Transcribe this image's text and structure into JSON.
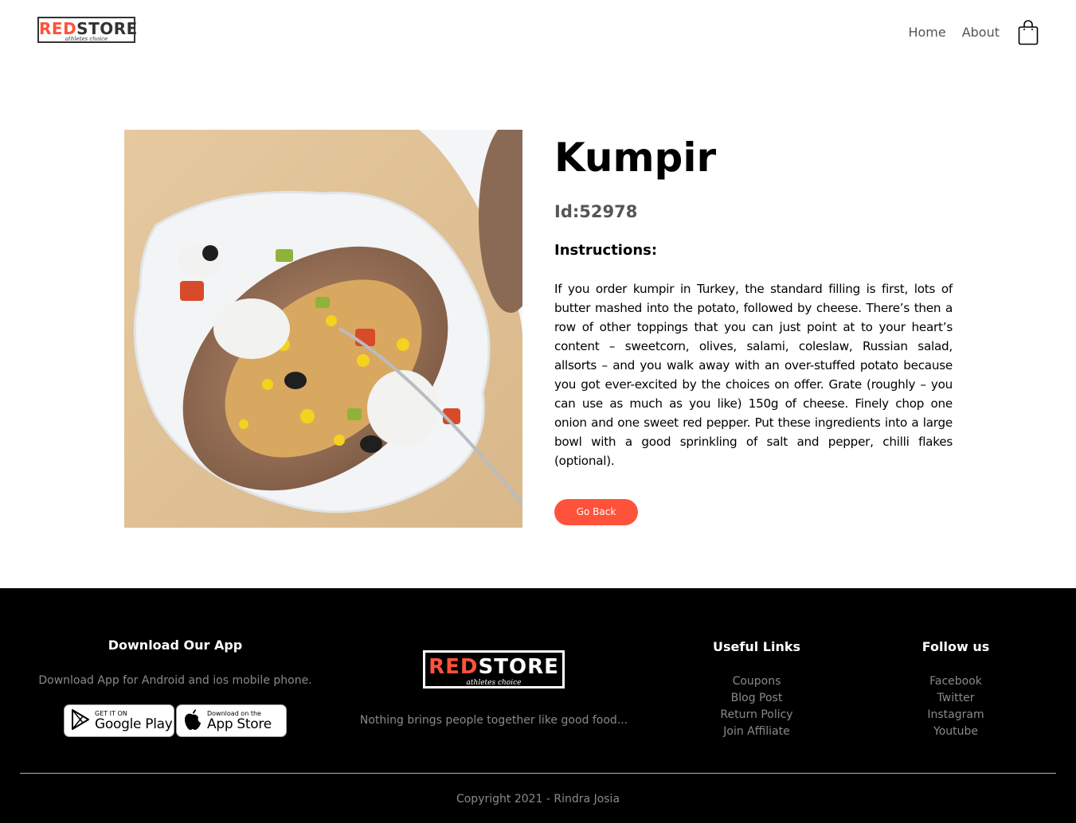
{
  "header": {
    "logo_word_red": "RED",
    "logo_word_dark": "STORE",
    "logo_tagline": "athletes choice",
    "nav": [
      {
        "label": "Home"
      },
      {
        "label": "About"
      }
    ],
    "cart_icon": "shopping-bag-icon"
  },
  "product": {
    "image_subject": "kumpir baked potato with toppings",
    "title": "Kumpir",
    "id_text": "Id:52978",
    "instructions_heading": "Instructions:",
    "instructions": "If you order kumpir in Turkey, the standard filling is first, lots of butter mashed into the potato, followed by cheese. There’s then a row of other toppings that you can just point at to your heart’s content – sweetcorn, olives, salami, coleslaw, Russian salad, allsorts – and you walk away with an over-stuffed potato because you got ever-excited by the choices on offer. Grate (roughly – you can use as much as you like) 150g of cheese. Finely chop one onion and one sweet red pepper. Put these ingredients into a large bowl with a good sprinkling of salt and pepper, chilli flakes (optional).",
    "go_back_label": "Go Back"
  },
  "footer": {
    "download": {
      "heading": "Download Our App",
      "text": "Download App for Android and ios mobile phone.",
      "google_play": {
        "small": "GET IT ON",
        "big": "Google Play"
      },
      "app_store": {
        "small": "Download on the",
        "big": "App Store"
      }
    },
    "logo_word_red": "RED",
    "logo_word_white": "STORE",
    "logo_tagline": "athletes choice",
    "tagline": "Nothing brings people together like good food...",
    "useful_links": {
      "heading": "Useful Links",
      "items": [
        "Coupons",
        "Blog Post",
        "Return Policy",
        "Join Affiliate"
      ]
    },
    "follow_us": {
      "heading": "Follow us",
      "items": [
        "Facebook",
        "Twitter",
        "Instagram",
        "Youtube"
      ]
    },
    "copyright": "Copyright 2021 - Rindra Josia"
  },
  "colors": {
    "accent": "#ff523b",
    "footer_bg": "#000000",
    "muted_text": "#8a8a8a"
  }
}
